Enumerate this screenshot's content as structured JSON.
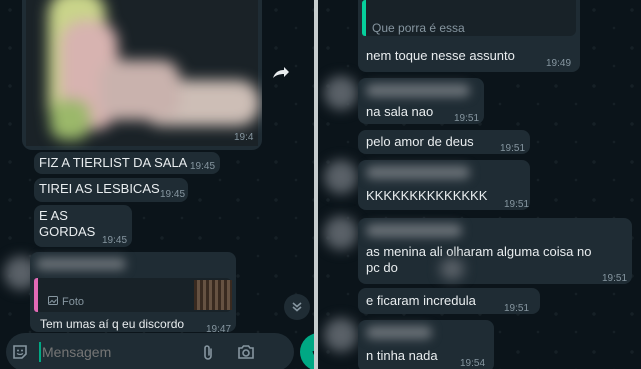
{
  "left": {
    "photo_time": "19:4",
    "messages": [
      {
        "text": "FIZ A TIERLIST DA SALA",
        "time": "19:45"
      },
      {
        "text": "TIREI AS LESBICAS",
        "time": "19:45"
      },
      {
        "text": "E AS\nGORDAS",
        "time": "19:45"
      }
    ],
    "reply": {
      "quoted_type": "Foto",
      "text": "Tem umas aí q eu discordo",
      "time": "19:47"
    },
    "composer": {
      "placeholder": "Mensagem"
    }
  },
  "right": {
    "quoted_text": "Que porra é essa",
    "messages": [
      {
        "text": "nem toque nesse assunto",
        "time": "19:49"
      },
      {
        "text": "na sala nao",
        "time": "19:51"
      },
      {
        "text": "pelo amor de deus",
        "time": "19:51"
      },
      {
        "text": "KKKKKKKKKKKKKK",
        "time": "19:51"
      },
      {
        "text": "as menina ali olharam alguma coisa no\npc do",
        "time": "19:51"
      },
      {
        "text": "e ficaram incredula",
        "time": "19:51"
      },
      {
        "text": "n tinha nada",
        "time": "19:54"
      }
    ]
  },
  "colors": {
    "accent": "#00a884",
    "bubble": "#1f2c34",
    "background": "#0b141a",
    "quote_bar_pink": "#e26ab6",
    "quote_bar_green": "#06cf9c"
  },
  "icons": [
    "forward-icon",
    "sticker-icon",
    "attach-icon",
    "camera-icon",
    "mic-icon",
    "chevron-down-icon",
    "image-icon"
  ]
}
